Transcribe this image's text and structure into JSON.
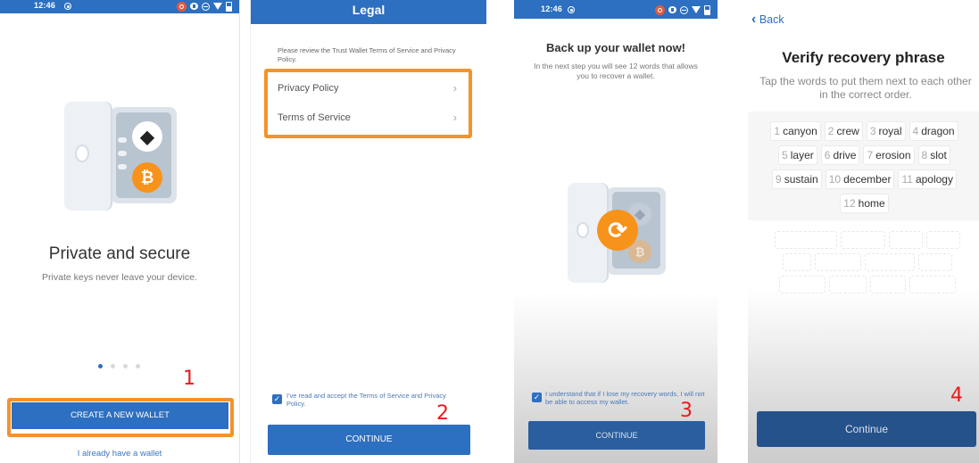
{
  "colors": {
    "brand_blue": "#2d6fc0",
    "highlight_orange": "#f5922b",
    "step_red": "#e8191b"
  },
  "status_bar": {
    "time": "12:46",
    "icons": [
      "target-icon",
      "record-icon",
      "eye-icon",
      "do-not-disturb-icon",
      "wifi-icon",
      "battery-icon"
    ]
  },
  "steps": [
    {
      "step_number": "1",
      "illustration": "safe-with-ethereum-and-bitcoin",
      "title": "Private and secure",
      "subtitle": "Private keys never leave your device.",
      "carousel": {
        "total": 4,
        "active": 1
      },
      "primary_button": "CREATE A NEW WALLET",
      "secondary_link": "I already have a wallet"
    },
    {
      "step_number": "2",
      "header_title": "Legal",
      "intro": "Please review the Trust Wallet Terms of Service and Privacy Policy.",
      "items": [
        {
          "label": "Privacy Policy",
          "icon": "chevron-right-icon"
        },
        {
          "label": "Terms of Service",
          "icon": "chevron-right-icon"
        }
      ],
      "checkbox": {
        "checked": true,
        "label": "I've read and accept the Terms of Service and Privacy Policy."
      },
      "primary_button": "CONTINUE"
    },
    {
      "step_number": "3",
      "title": "Back up your wallet now!",
      "subtitle": "In the next step you will see 12 words that allows you to recover a wallet.",
      "illustration": "safe-with-backup-refresh",
      "checkbox": {
        "checked": true,
        "label": "I understand that if I lose my recovery words, I will not be able to access my wallet."
      },
      "primary_button": "CONTINUE"
    },
    {
      "step_number": "4",
      "back_label": "Back",
      "title": "Verify recovery phrase",
      "subtitle": "Tap the words to put them next to each other in the correct order.",
      "words": [
        {
          "n": "1",
          "word": "canyon"
        },
        {
          "n": "2",
          "word": "crew"
        },
        {
          "n": "3",
          "word": "royal"
        },
        {
          "n": "4",
          "word": "dragon"
        },
        {
          "n": "5",
          "word": "layer"
        },
        {
          "n": "6",
          "word": "drive"
        },
        {
          "n": "7",
          "word": "erosion"
        },
        {
          "n": "8",
          "word": "slot"
        },
        {
          "n": "9",
          "word": "sustain"
        },
        {
          "n": "10",
          "word": "december"
        },
        {
          "n": "11",
          "word": "apology"
        },
        {
          "n": "12",
          "word": "home"
        }
      ],
      "empty_slots": 12,
      "primary_button": "Continue"
    }
  ]
}
